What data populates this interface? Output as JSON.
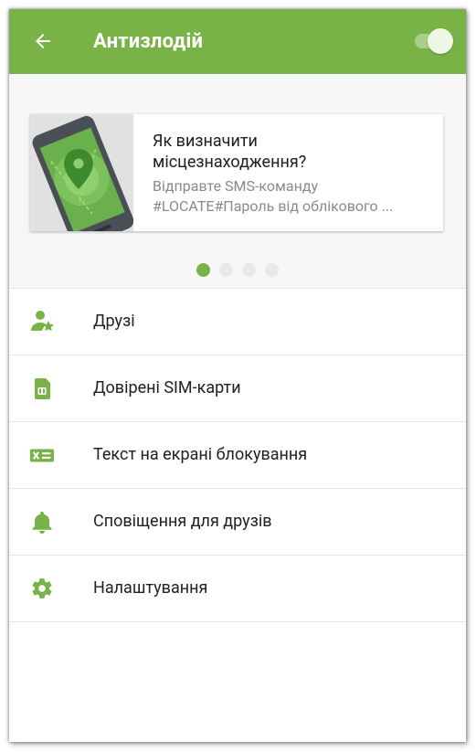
{
  "colors": {
    "accent": "#79b347",
    "background": "#ffffff",
    "banner_background": "#f7f7f7",
    "primary_text": "#212121",
    "secondary_text": "#8a8a8a"
  },
  "app_bar": {
    "title": "Антизлодій",
    "back_icon": "arrow-back-icon",
    "toggle_state": "on"
  },
  "banner": {
    "image_icon": "phone-location-icon",
    "title_lines": [
      "Як визначити",
      "місцезнаходження?"
    ],
    "text_lines": [
      "Відправте SMS-команду",
      "#LOCATE#Пароль від облікового ..."
    ],
    "pager": {
      "total": 4,
      "active_index": 0
    }
  },
  "menu": {
    "items": [
      {
        "label": "Друзі",
        "icon": "person-star-icon"
      },
      {
        "label": "Довірені SIM-карти",
        "icon": "sim-card-icon"
      },
      {
        "label": "Текст на екрані блокування",
        "icon": "lockscreen-text-icon"
      },
      {
        "label": "Сповіщення для друзів",
        "icon": "bell-icon"
      },
      {
        "label": "Налаштування",
        "icon": "gear-icon"
      }
    ]
  }
}
